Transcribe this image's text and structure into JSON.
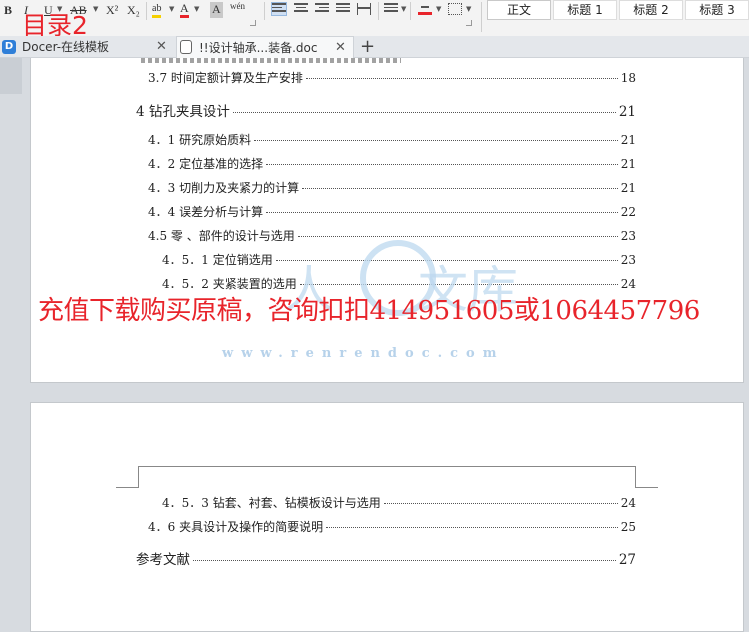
{
  "ribbon": {
    "bold": "B",
    "italic": "I",
    "underline": "U",
    "strike": "AB",
    "superscript": "X²",
    "subscript": "X₂",
    "highlight": "ab",
    "fontcolor": "A",
    "charshade": "A",
    "phonetic": "wén",
    "styles": [
      "正文",
      "标题 1",
      "标题 2",
      "标题 3"
    ]
  },
  "overlay_title": "目录2",
  "tabs": [
    {
      "label": "Docer-在线模板"
    },
    {
      "label": "!!设计轴承...装备.doc"
    }
  ],
  "toc_page1": [
    {
      "text": "3.7 时间定额计算及生产安排",
      "page": "18"
    },
    {
      "text": "4 钻孔夹具设计",
      "page": "21"
    },
    {
      "text": "4．1 研究原始质料",
      "page": "21"
    },
    {
      "text": "4．2 定位基准的选择",
      "page": "21"
    },
    {
      "text": "4．3 切削力及夹紧力的计算",
      "page": "21"
    },
    {
      "text": "4．4 误差分析与计算",
      "page": "22"
    },
    {
      "text": "4.5  零 、部件的设计与选用",
      "page": "23"
    },
    {
      "text": "4．5．1 定位销选用",
      "page": "23"
    },
    {
      "text": "4．5．2 夹紧装置的选用",
      "page": "24"
    }
  ],
  "toc_page2": [
    {
      "text": "4．5．3  钻套、衬套、钻模板设计与选用",
      "page": "24"
    },
    {
      "text": "4．6 夹具设计及操作的简要说明",
      "page": "25"
    },
    {
      "text": "参考文献",
      "page": "27"
    }
  ],
  "promo_text": "充值下载购买原稿，咨询扣扣414951605或1064457796",
  "watermark": {
    "url": "www.renrendoc.com",
    "glyph_left": "人",
    "glyph_right": "文库"
  },
  "colors": {
    "accent_red": "#e8242b",
    "watermark_blue": "#bcd8ef",
    "docer_icon": "#2f7fd8"
  }
}
